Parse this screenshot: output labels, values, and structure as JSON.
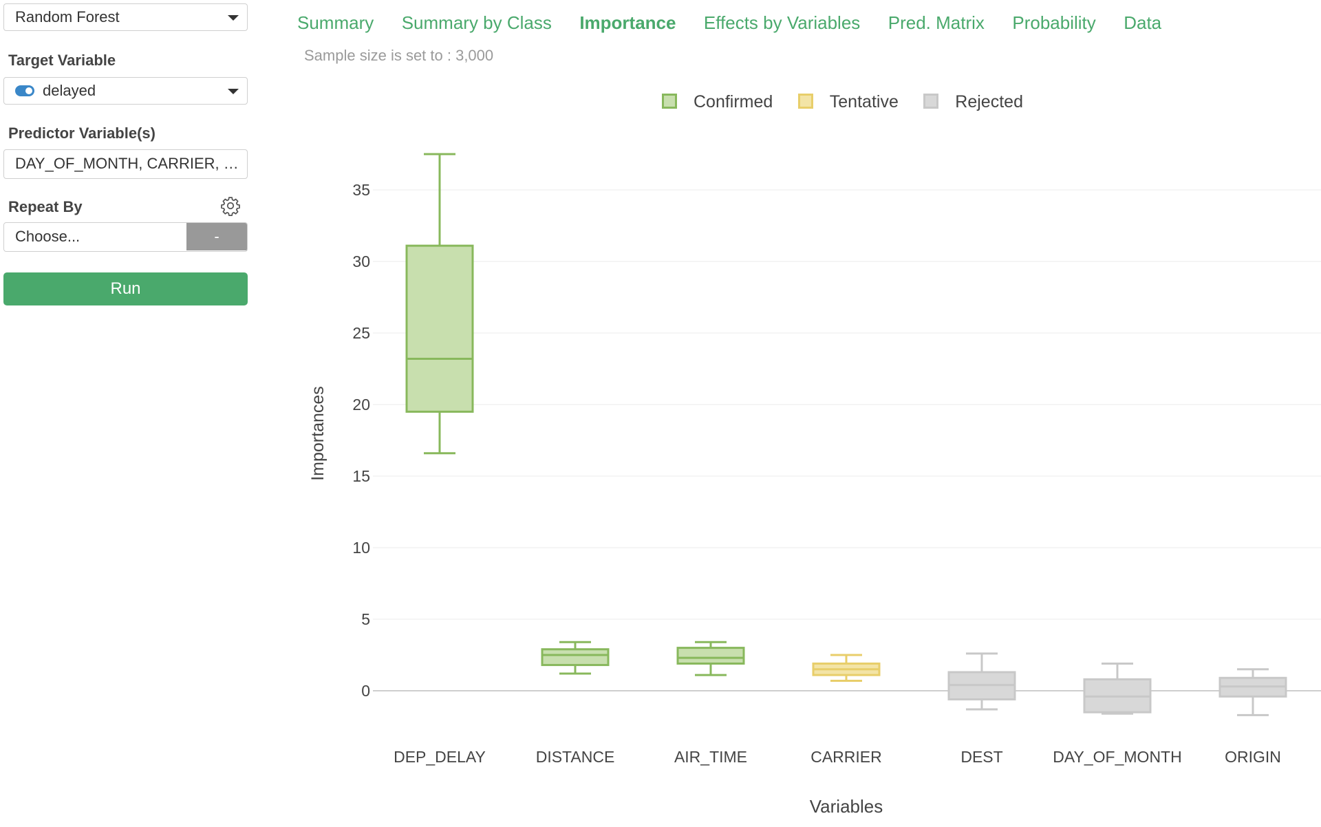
{
  "sidebar": {
    "model_select": "Random Forest",
    "target_label": "Target Variable",
    "target_value": "delayed",
    "predictor_label": "Predictor Variable(s)",
    "predictor_value": "DAY_OF_MONTH, CARRIER, ORIGIN, DEST, DEP_DELAY, AIR_TIME, DISTANCE",
    "repeat_label": "Repeat By",
    "repeat_placeholder": "Choose...",
    "repeat_button": "-",
    "run_button": "Run"
  },
  "tabs": [
    {
      "label": "Summary",
      "active": false
    },
    {
      "label": "Summary by Class",
      "active": false
    },
    {
      "label": "Importance",
      "active": true
    },
    {
      "label": "Effects by Variables",
      "active": false
    },
    {
      "label": "Pred. Matrix",
      "active": false
    },
    {
      "label": "Probability",
      "active": false
    },
    {
      "label": "Data",
      "active": false
    }
  ],
  "sample_note": "Sample size is set to : 3,000",
  "colors": {
    "accent": "#4aa96c",
    "confirmed_fill": "#c8dfae",
    "confirmed_line": "#88b85c",
    "tentative_fill": "#f3e4a6",
    "tentative_line": "#e8ce6a",
    "rejected_fill": "#d8d8d8",
    "rejected_line": "#c8c8c8"
  },
  "chart_data": {
    "type": "box",
    "xlabel": "Variables",
    "ylabel": "Importances",
    "ylim": [
      -4,
      38
    ],
    "yticks": [
      0,
      5,
      10,
      15,
      20,
      25,
      30,
      35
    ],
    "grid": true,
    "legend": {
      "position": "top-center",
      "entries": [
        "Confirmed",
        "Tentative",
        "Rejected"
      ]
    },
    "boxes": [
      {
        "variable": "DEP_DELAY",
        "decision": "Confirmed",
        "min": 16.6,
        "q1": 19.5,
        "median": 23.2,
        "q3": 31.1,
        "max": 37.5
      },
      {
        "variable": "DISTANCE",
        "decision": "Confirmed",
        "min": 1.2,
        "q1": 1.8,
        "median": 2.5,
        "q3": 2.9,
        "max": 3.4
      },
      {
        "variable": "AIR_TIME",
        "decision": "Confirmed",
        "min": 1.1,
        "q1": 1.9,
        "median": 2.3,
        "q3": 3.0,
        "max": 3.4
      },
      {
        "variable": "CARRIER",
        "decision": "Tentative",
        "min": 0.7,
        "q1": 1.1,
        "median": 1.5,
        "q3": 1.9,
        "max": 2.5
      },
      {
        "variable": "DEST",
        "decision": "Rejected",
        "min": -1.3,
        "q1": -0.6,
        "median": 0.4,
        "q3": 1.3,
        "max": 2.6
      },
      {
        "variable": "DAY_OF_MONTH",
        "decision": "Rejected",
        "min": -1.6,
        "q1": -1.5,
        "median": -0.4,
        "q3": 0.8,
        "max": 1.9
      },
      {
        "variable": "ORIGIN",
        "decision": "Rejected",
        "min": -1.7,
        "q1": -0.4,
        "median": 0.3,
        "q3": 0.9,
        "max": 1.5
      }
    ]
  }
}
